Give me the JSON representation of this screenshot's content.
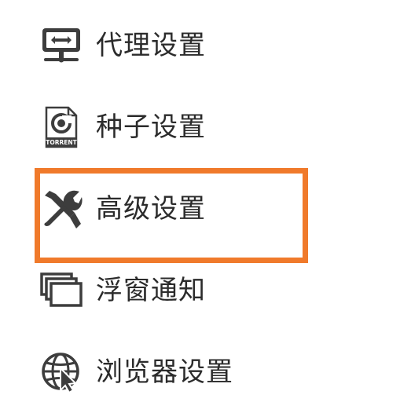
{
  "menu": {
    "items": [
      {
        "label": "代理设置",
        "icon": "proxy-monitor-icon"
      },
      {
        "label": "种子设置",
        "icon": "torrent-file-icon",
        "icon_text": "TORRENT"
      },
      {
        "label": "高级设置",
        "icon": "wrench-screwdriver-icon"
      },
      {
        "label": "浮窗通知",
        "icon": "stacked-windows-icon"
      },
      {
        "label": "浏览器设置",
        "icon": "globe-cursor-icon"
      }
    ],
    "highlighted_index": 2
  },
  "colors": {
    "highlight": "#f07a2b",
    "icon": "#3d3d3d",
    "text": "#2b2b2b"
  }
}
